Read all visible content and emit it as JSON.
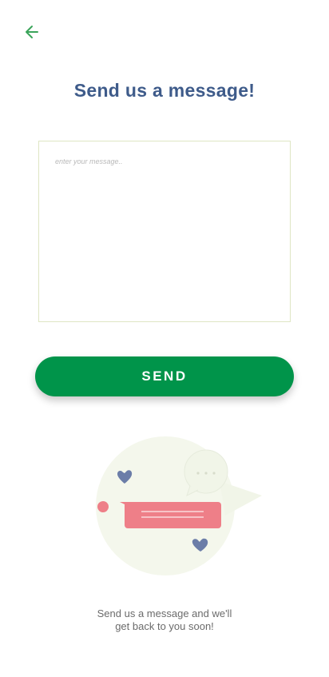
{
  "header": {
    "back_icon": "arrow-left-icon",
    "accent_color": "#3aa45a"
  },
  "main": {
    "title": "Send us a message!",
    "message_placeholder": "enter your message..",
    "message_value": "",
    "send_label": "SEND",
    "send_color": "#00944a",
    "title_color": "#3e5b8a"
  },
  "illustration": {
    "name": "chat-bubbles-illustration",
    "icons": [
      "heart-icon",
      "chat-bubble-icon",
      "typing-bubble-icon"
    ]
  },
  "footer": {
    "line1": "Send us a message and we'll",
    "line2": "get back to you soon!"
  }
}
